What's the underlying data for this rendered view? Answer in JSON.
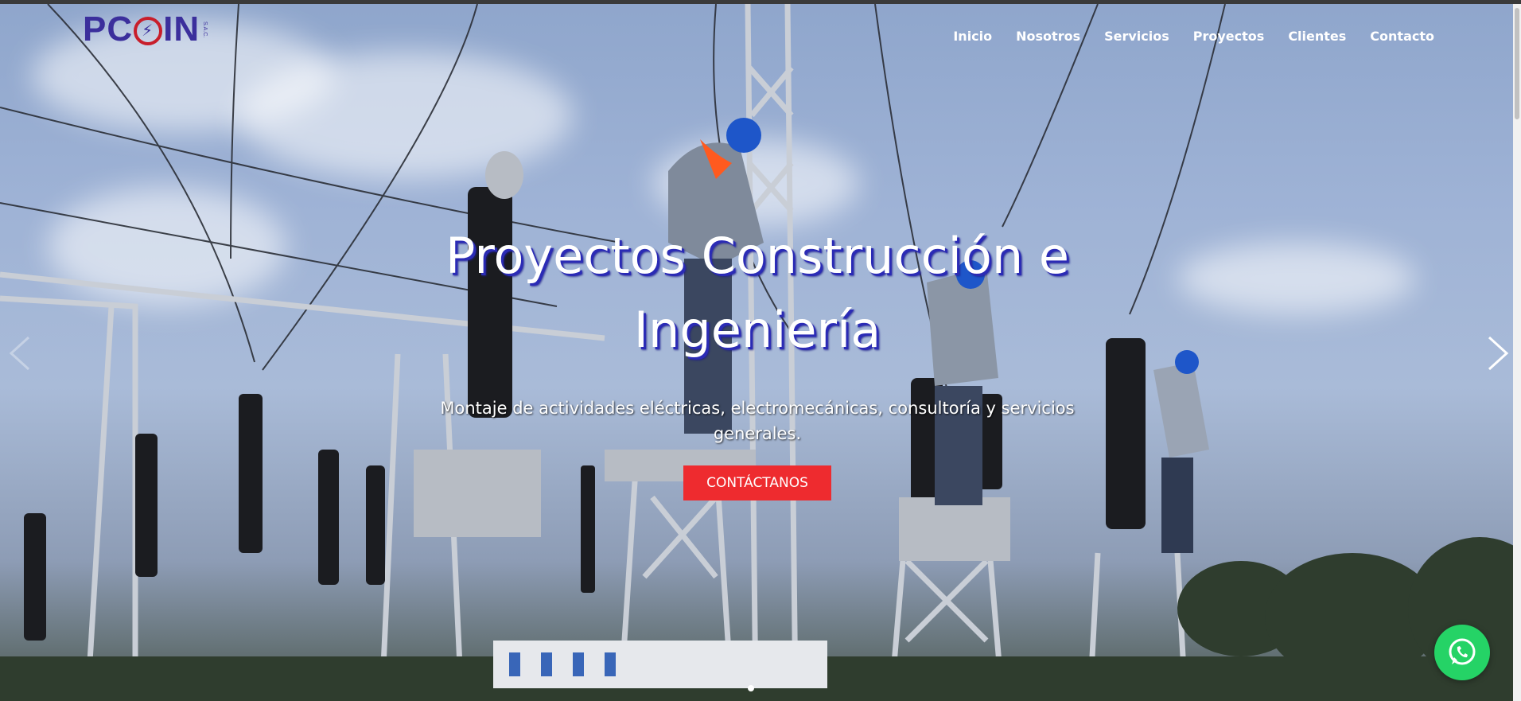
{
  "brand": {
    "logo_text_left": "PC",
    "logo_text_right": "IN",
    "logo_sub": "S.A.C.",
    "primary_color": "#3b2f9c",
    "accent_color": "#c81e2b"
  },
  "nav": {
    "items": [
      {
        "label": "Inicio"
      },
      {
        "label": "Nosotros"
      },
      {
        "label": "Servicios"
      },
      {
        "label": "Proyectos"
      },
      {
        "label": "Clientes"
      },
      {
        "label": "Contacto"
      }
    ]
  },
  "hero": {
    "title": "Proyectos Construcción e Ingeniería",
    "subtitle": "Montaje de actividades eléctricas, electromecánicas, consultoría y servicios generales.",
    "cta_label": "CONTÁCTANOS",
    "cta_color": "#ee2b2f",
    "title_shadow_color": "#2b2bb5"
  },
  "slider": {
    "prev_icon": "chevron-left-icon",
    "next_icon": "chevron-right-icon",
    "slide_count": 1,
    "active_index": 0
  },
  "floating": {
    "whatsapp_icon": "whatsapp-icon",
    "whatsapp_color": "#25d366"
  }
}
